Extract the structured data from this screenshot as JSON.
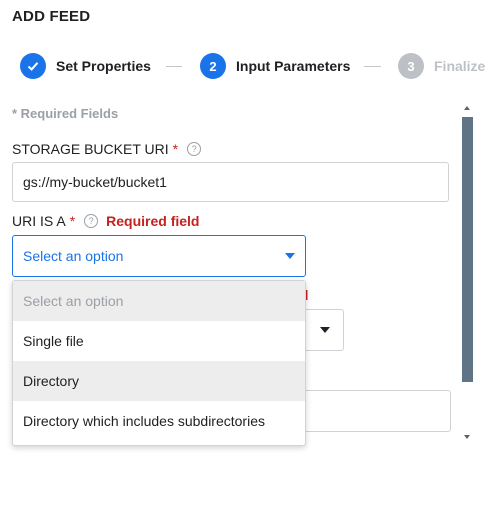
{
  "header": {
    "title": "ADD FEED"
  },
  "stepper": {
    "steps": [
      {
        "number": "✓",
        "label": "Set Properties",
        "state": "done"
      },
      {
        "number": "2",
        "label": "Input Parameters",
        "state": "active"
      },
      {
        "number": "3",
        "label": "Finalize",
        "state": "pending"
      }
    ]
  },
  "form": {
    "required_note": "* Required Fields",
    "bucket_uri": {
      "label": "STORAGE BUCKET URI",
      "required_marker": "*",
      "help_icon": "?",
      "value": "gs://my-bucket/bucket1"
    },
    "uri_is_a": {
      "label": "URI IS A",
      "required_marker": "*",
      "help_icon": "?",
      "error": "Required field",
      "selected": "Select an option",
      "options": [
        "Select an option",
        "Single file",
        "Directory",
        "Directory which includes subdirectories"
      ]
    },
    "background_error_fragment": "ld"
  },
  "colors": {
    "accent": "#1a73e8",
    "error": "#c5221f",
    "muted": "#bdc1c6",
    "scrollbar": "#5f7587"
  }
}
